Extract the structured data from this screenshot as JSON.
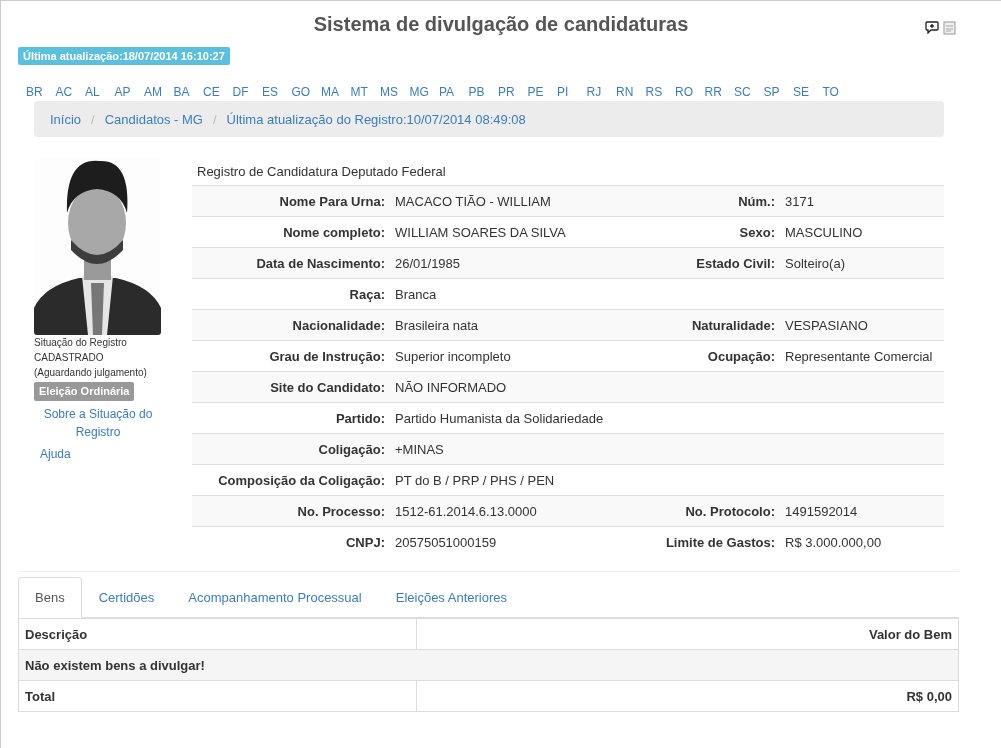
{
  "header": {
    "title": "Sistema de divulgação de candidaturas",
    "last_update": "Última atualização:18/07/2014 16:10:27"
  },
  "states": [
    "BR",
    "AC",
    "AL",
    "AP",
    "AM",
    "BA",
    "CE",
    "DF",
    "ES",
    "GO",
    "MA",
    "MT",
    "MS",
    "MG",
    "PA",
    "PB",
    "PR",
    "PE",
    "PI",
    "RJ",
    "RN",
    "RS",
    "RO",
    "RR",
    "SC",
    "SP",
    "SE",
    "TO"
  ],
  "breadcrumb": {
    "separator": "/",
    "items": [
      "Início",
      "Candidatos - MG",
      "Última atualização do Registro:10/07/2014 08:49:08"
    ]
  },
  "sidebar": {
    "photo": {
      "kind": "picture"
    },
    "situation_label": "Situação do Registro",
    "situation_value": "CADASTRADO",
    "situation_note": "(Aguardando julgamento)",
    "election_badge": "Eleição Ordinária",
    "links": [
      "Sobre a Situação do Registro",
      "Ajuda"
    ]
  },
  "details": {
    "caption": "Registro de Candidatura Deputado Federal",
    "rows": [
      {
        "label": "Nome Para Urna:",
        "value": "MACACO TIÃO - WILLIAM",
        "label_2": "Núm.:",
        "value_2": "3171"
      },
      {
        "label": "Nome completo:",
        "value": "WILLIAM SOARES DA SILVA",
        "label_2": "Sexo:",
        "value_2": "MASCULINO"
      },
      {
        "label": "Data de Nascimento:",
        "value": "26/01/1985",
        "label_2": "Estado Civil:",
        "value_2": "Solteiro(a)"
      },
      {
        "label": "Raça:",
        "value": "Branca"
      },
      {
        "label": "Nacionalidade:",
        "value": "Brasileira nata",
        "label_2": "Naturalidade:",
        "value_2": "VESPASIANO"
      },
      {
        "label": "Grau de Instrução:",
        "value": "Superior incompleto",
        "label_2": "Ocupação:",
        "value_2": "Representante Comercial"
      },
      {
        "label": "Site do Candidato:",
        "value": "NÃO INFORMADO"
      },
      {
        "label": "Partido:",
        "value": "Partido Humanista da Solidariedade"
      },
      {
        "label": "Coligação:",
        "value": "+MINAS"
      },
      {
        "label": "Composição da Coligação:",
        "value": "PT do B / PRP / PHS / PEN"
      },
      {
        "label": "No. Processo:",
        "value": "1512-61.2014.6.13.0000",
        "label_2": "No. Protocolo:",
        "value_2": "1491592014"
      },
      {
        "label": "CNPJ:",
        "value": "20575051000159",
        "label_2": "Limite de Gastos:",
        "value_2": "R$ 3.000.000,00"
      }
    ]
  },
  "tabs": [
    {
      "label": "Bens",
      "selected": true
    },
    {
      "label": "Certidões",
      "selected": false
    },
    {
      "label": "Acompanhamento Processual",
      "selected": false
    },
    {
      "label": "Eleições Anteriores",
      "selected": false
    }
  ],
  "assets_table": {
    "columns": [
      "Descrição",
      "Valor do Bem"
    ],
    "rows": [
      {
        "kind": "message",
        "cells": [
          {
            "text": "Não existem bens a divulgar!",
            "colspan": 2
          }
        ]
      },
      {
        "kind": "total",
        "cells": [
          "Total",
          "R$ 0,00"
        ]
      }
    ]
  }
}
